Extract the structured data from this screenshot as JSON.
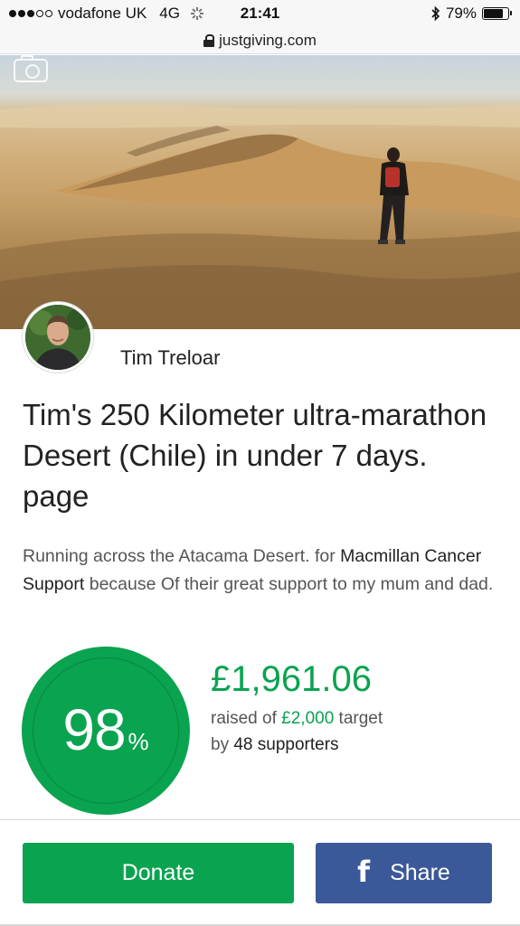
{
  "status_bar": {
    "carrier": "vodafone UK",
    "network": "4G",
    "time": "21:41",
    "battery": "79%",
    "battery_level": 0.79
  },
  "browser": {
    "url": "justgiving.com"
  },
  "fundraiser": {
    "owner_name": "Tim Treloar",
    "title": "Tim's 250 Kilometer ultra-marathon Desert (Chile) in under 7 days. page",
    "description_before": "Running across the Atacama Desert. for ",
    "charity": "Macmillan Cancer Support",
    "description_after": " because Of their great support to my mum and dad."
  },
  "progress": {
    "percent": "98",
    "percent_sign": "%",
    "amount_raised": "£1,961.06",
    "raised_prefix": "raised of ",
    "target": "£2,000",
    "raised_suffix": " target",
    "supporters_prefix": "by ",
    "supporters": "48 supporters"
  },
  "actions": {
    "donate_label": "Donate",
    "share_label": "Share",
    "share_icon": "f"
  },
  "colors": {
    "brand_green": "#0aa34f",
    "facebook_blue": "#3b5998"
  },
  "icons": [
    "signal-icon",
    "loading-spinner-icon",
    "bluetooth-icon",
    "battery-icon",
    "lock-icon",
    "camera-icon",
    "facebook-icon"
  ]
}
